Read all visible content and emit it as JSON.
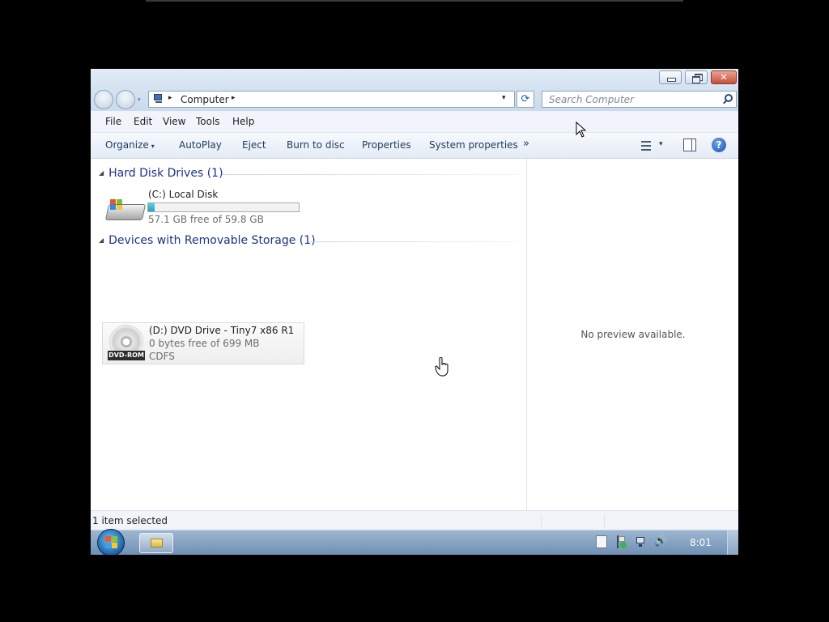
{
  "window": {
    "caption_buttons": {
      "minimize": "minimize-icon",
      "maximize": "restore-icon",
      "close": "close-icon",
      "close_glyph": "✕"
    }
  },
  "nav": {
    "address": {
      "location": "Computer",
      "separator": "▸",
      "dropdown": "▾"
    },
    "refresh_glyph": "⟳",
    "search": {
      "placeholder": "Search Computer"
    }
  },
  "menu": {
    "file": "File",
    "edit": "Edit",
    "view": "View",
    "tools": "Tools",
    "help": "Help"
  },
  "commands": {
    "organize": "Organize",
    "organize_dd": "▾",
    "autoplay": "AutoPlay",
    "eject": "Eject",
    "burn": "Burn to disc",
    "properties": "Properties",
    "system_properties": "System properties",
    "more": "»",
    "view_dd": "▾",
    "help_glyph": "?"
  },
  "groups": {
    "hard_disk": {
      "header": "Hard Disk Drives (1)",
      "collapse_glyph": "◢",
      "drive": {
        "name": "(C:) Local Disk",
        "free_text": "57.1 GB free of 59.8 GB",
        "used_fraction": 0.045
      }
    },
    "removable": {
      "header": "Devices with Removable Storage (1)",
      "collapse_glyph": "◢",
      "drive": {
        "name": "(D:) DVD Drive - Tiny7 x86 R1",
        "free_text": "0 bytes free of 699 MB",
        "filesystem": "CDFS",
        "icon_label": "DVD-ROM"
      }
    }
  },
  "preview": {
    "text": "No preview available."
  },
  "status": {
    "text": "1 item selected"
  },
  "taskbar": {
    "clock": "8:01",
    "volume_glyph": "🔊"
  },
  "colors": {
    "group_header": "#1e3287",
    "usage_bar": "#26a0c2",
    "taskbar": "#6e8fb3"
  }
}
